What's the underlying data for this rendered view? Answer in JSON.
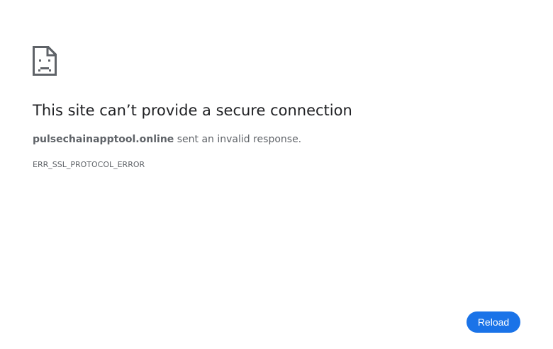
{
  "error_page": {
    "icon": "sad-page-icon",
    "title": "This site can’t provide a secure connection",
    "host": "pulsechainapptool.online",
    "message_suffix": " sent an invalid response.",
    "error_code": "ERR_SSL_PROTOCOL_ERROR",
    "reload_label": "Reload"
  },
  "colors": {
    "background": "#ffffff",
    "title": "#202124",
    "text": "#5f6368",
    "icon": "#5f6368",
    "button": "#1a73e8",
    "button_text": "#ffffff"
  }
}
